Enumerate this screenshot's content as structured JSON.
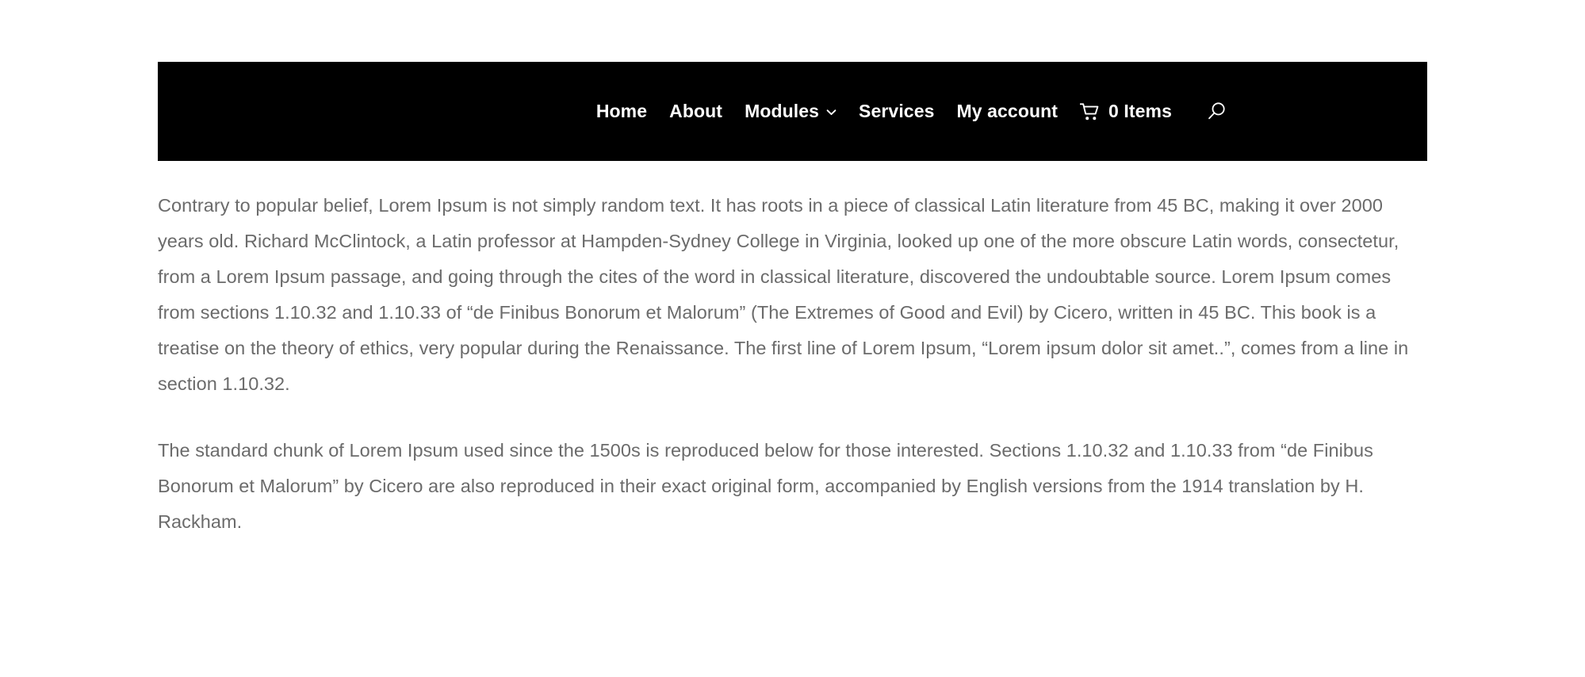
{
  "colors": {
    "navbar_background": "#000000",
    "navbar_text": "#ffffff",
    "page_background": "#ffffff",
    "body_text": "#6b6b6b"
  },
  "navbar": {
    "items": [
      {
        "label": "Home",
        "has_submenu": false
      },
      {
        "label": "About",
        "has_submenu": false
      },
      {
        "label": "Modules",
        "has_submenu": true,
        "submenu_icon": "chevron-down-icon"
      },
      {
        "label": "Services",
        "has_submenu": false
      },
      {
        "label": "My account",
        "has_submenu": false
      }
    ],
    "cart": {
      "icon": "shopping-cart-icon",
      "count_label": "0 Items"
    },
    "search": {
      "icon": "search-icon"
    }
  },
  "main": {
    "paragraphs": [
      "Contrary to popular belief, Lorem Ipsum is not simply random text. It has roots in a piece of classical Latin literature from 45 BC, making it over 2000 years old. Richard McClintock, a Latin professor at Hampden-Sydney College in Virginia, looked up one of the more obscure Latin words, consectetur, from a Lorem Ipsum passage, and going through the cites of the word in classical literature, discovered the undoubtable source. Lorem Ipsum comes from sections 1.10.32 and 1.10.33 of “de Finibus Bonorum et Malorum” (The Extremes of Good and Evil) by Cicero, written in 45 BC. This book is a treatise on the theory of ethics, very popular during the Renaissance. The first line of Lorem Ipsum, “Lorem ipsum dolor sit amet..”, comes from a line in section 1.10.32.",
      "The standard chunk of Lorem Ipsum used since the 1500s is reproduced below for those interested. Sections 1.10.32 and 1.10.33 from “de Finibus Bonorum et Malorum” by Cicero are also reproduced in their exact original form, accompanied by English versions from the 1914 translation by H. Rackham."
    ]
  }
}
